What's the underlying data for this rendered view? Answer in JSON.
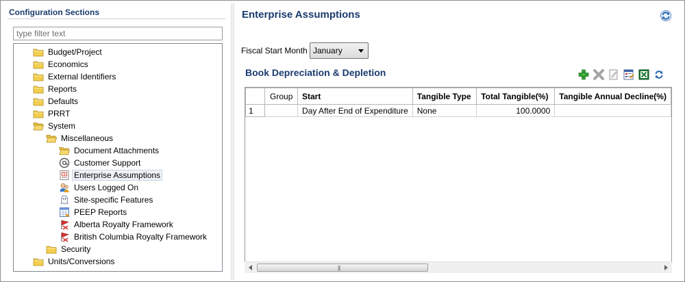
{
  "sidebar": {
    "title": "Configuration Sections",
    "filter_placeholder": "type filter text",
    "tree": [
      {
        "label": "Budget/Project",
        "icon": "folder-icon",
        "level": 0
      },
      {
        "label": "Economics",
        "icon": "folder-icon",
        "level": 0
      },
      {
        "label": "External Identifiers",
        "icon": "folder-icon",
        "level": 0
      },
      {
        "label": "Reports",
        "icon": "folder-icon",
        "level": 0
      },
      {
        "label": "Defaults",
        "icon": "folder-icon",
        "level": 0
      },
      {
        "label": "PRRT",
        "icon": "folder-icon",
        "level": 0
      },
      {
        "label": "System",
        "icon": "folder-open-icon",
        "level": 0
      },
      {
        "label": "Miscellaneous",
        "icon": "folder-open-icon",
        "level": 1
      },
      {
        "label": "Document Attachments",
        "icon": "folder-open-icon",
        "level": 2
      },
      {
        "label": "Customer Support",
        "icon": "at-sign-icon",
        "level": 2
      },
      {
        "label": "Enterprise Assumptions",
        "icon": "enterprise-icon",
        "level": 2,
        "selected": true
      },
      {
        "label": "Users Logged On",
        "icon": "users-icon",
        "level": 2
      },
      {
        "label": "Site-specific Features",
        "icon": "ghost-icon",
        "level": 2
      },
      {
        "label": "PEEP Reports",
        "icon": "report-grid-icon",
        "level": 2
      },
      {
        "label": "Alberta Royalty Framework",
        "icon": "royalty-flag-icon",
        "level": 2
      },
      {
        "label": "British Columbia Royalty Framework",
        "icon": "royalty-flag-icon",
        "level": 2
      },
      {
        "label": "Security",
        "icon": "folder-icon",
        "level": 1
      },
      {
        "label": "Units/Conversions",
        "icon": "folder-icon",
        "level": 0
      }
    ]
  },
  "main": {
    "title": "Enterprise Assumptions",
    "refresh_icon": "refresh-icon",
    "fiscal_label": "Fiscal Start Month",
    "fiscal_value": "January",
    "grid_title": "Book Depreciation & Depletion",
    "toolbar": [
      "add-row-icon",
      "delete-row-icon",
      "edit-icon",
      "properties-icon",
      "export-excel-icon",
      "refresh-icon"
    ],
    "columns": [
      "",
      "Group",
      "Start",
      "Tangible Type",
      "Total Tangible(%)",
      "Tangible Annual Decline(%)"
    ],
    "rows": [
      [
        "1",
        "",
        "Day After End of Expenditure",
        "None",
        "100.0000",
        ""
      ]
    ]
  },
  "colors": {
    "title_blue": "#1a3b6e",
    "folder_yellow": "#f3cf4f",
    "add_green": "#2e9e2e",
    "excel_green": "#1d7a35"
  }
}
